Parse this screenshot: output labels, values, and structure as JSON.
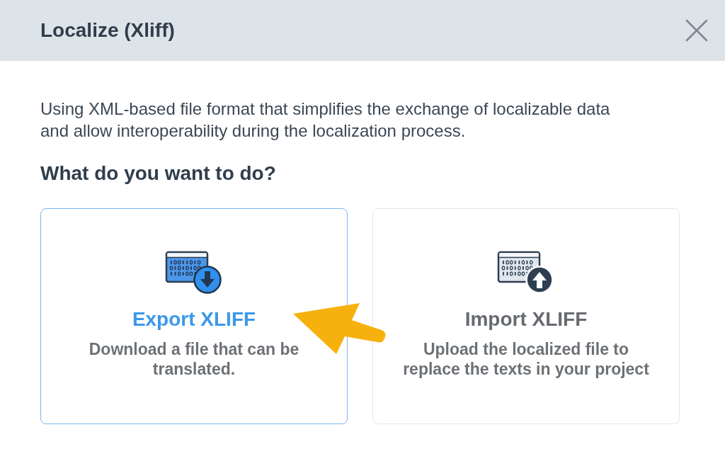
{
  "dialog": {
    "title": "Localize (Xliff)",
    "closable": true
  },
  "description": "Using XML-based file format that simplifies the exchange of localizable data and allow interoperability during the localization process.",
  "question": "What do you want to do?",
  "options": [
    {
      "kind": "export",
      "title": "Export XLIFF",
      "description": "Download a file that can be translated.",
      "selected": true
    },
    {
      "kind": "import",
      "title": "Import XLIFF",
      "description": "Upload the localized file to replace the texts in your project",
      "selected": false
    }
  ],
  "pointer_arrow": true
}
